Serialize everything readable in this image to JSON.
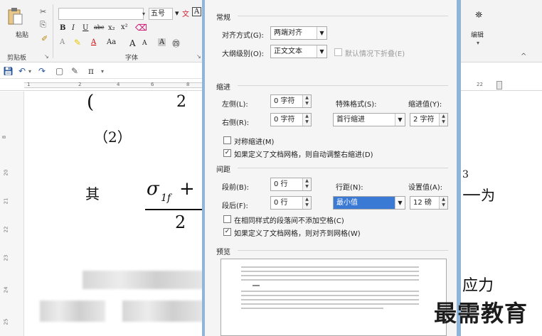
{
  "ribbon": {
    "paste_label": "粘贴",
    "font_size": "五号",
    "bold": "B",
    "italic": "I",
    "underline": "U",
    "strikethrough": "abc",
    "subscript": "x₂",
    "superscript": "x²",
    "clear_format": "A",
    "change_case": "Aa",
    "grow_font": "A",
    "shrink_font": "A",
    "clipboard_group": "剪贴板",
    "font_group": "字体",
    "edit_group": "编辑"
  },
  "qat": {
    "pi": "π"
  },
  "ruler": {
    "ticks": [
      "1",
      "2",
      "4",
      "6",
      "8"
    ],
    "right_ticks": [
      "22"
    ]
  },
  "vruler": {
    "ticks": [
      "8",
      "20",
      "21",
      "22",
      "23",
      "24",
      "25"
    ]
  },
  "document": {
    "paren_fragment": "(",
    "sub2": "2",
    "label2": "（2）",
    "qi": "其",
    "sigma_term": "σ",
    "sigma_sub": "1f",
    "plus": "+",
    "denominator": "2",
    "superscript_3": "3",
    "wei": "为",
    "yingli": "应力"
  },
  "dialog": {
    "general": {
      "title": "常规",
      "align_label": "对齐方式(G):",
      "align_value": "两端对齐",
      "outline_label": "大纲级别(O):",
      "outline_value": "正文文本",
      "collapse_label": "默认情况下折叠(E)"
    },
    "indent": {
      "title": "缩进",
      "left_label": "左侧(L):",
      "left_value": "0 字符",
      "right_label": "右侧(R):",
      "right_value": "0 字符",
      "special_label": "特殊格式(S):",
      "special_value": "首行缩进",
      "by_label": "缩进值(Y):",
      "by_value": "2 字符",
      "mirror_label": "对称缩进(M)",
      "auto_adjust_label": "如果定义了文档网格，则自动调整右缩进(D)"
    },
    "spacing": {
      "title": "间距",
      "before_label": "段前(B):",
      "before_value": "0 行",
      "after_label": "段后(F):",
      "after_value": "0 行",
      "line_label": "行距(N):",
      "line_value": "最小值",
      "at_label": "设置值(A):",
      "at_value": "12 磅",
      "no_space_label": "在相同样式的段落间不添加空格(C)",
      "snap_grid_label": "如果定义了文档网格，则对齐到网格(W)"
    },
    "preview": {
      "title": "预览"
    }
  },
  "watermark": "最需教育"
}
